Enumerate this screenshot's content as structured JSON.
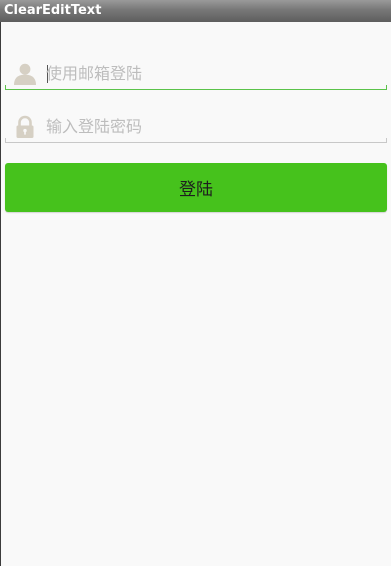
{
  "app": {
    "title": "ClearEditText"
  },
  "form": {
    "email": {
      "placeholder": "使用邮箱登陆",
      "value": "",
      "icon": "user-icon"
    },
    "password": {
      "placeholder": "输入登陆密码",
      "value": "",
      "icon": "lock-icon"
    },
    "login_label": "登陆"
  },
  "colors": {
    "accent": "#46c21c",
    "focus_underline": "#5bc34a",
    "idle_underline": "#c8c8c8",
    "icon": "#d6d0c4"
  }
}
